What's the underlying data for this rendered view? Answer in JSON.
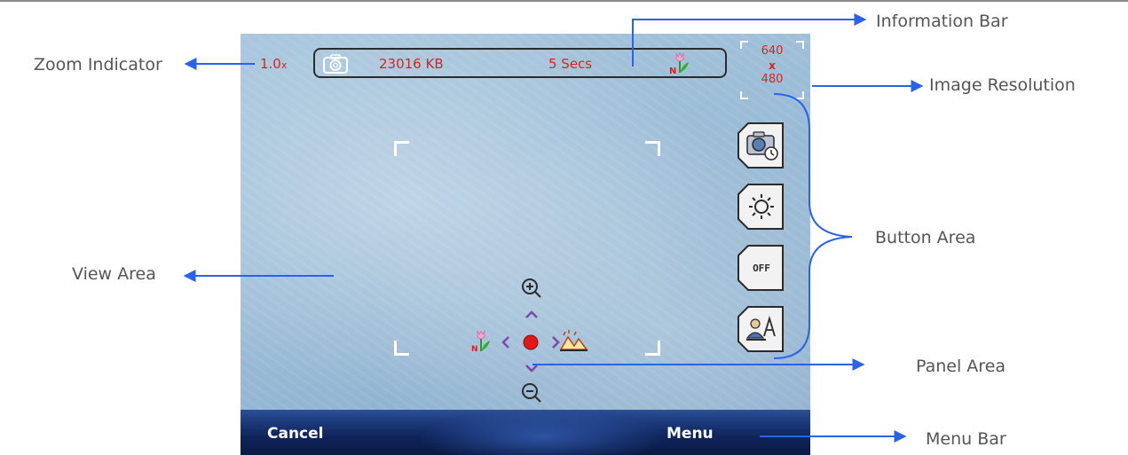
{
  "screen": {
    "zoom_value": "1.0",
    "zoom_suffix": "x",
    "info_bar": {
      "size": "23016 KB",
      "time": "5 Secs"
    },
    "resolution": {
      "width": "640",
      "times": "x",
      "height": "480"
    },
    "buttons": [
      {
        "icon": "camera-timer-icon"
      },
      {
        "icon": "brightness-icon"
      },
      {
        "icon": "flash-off-icon",
        "text": "OFF"
      },
      {
        "icon": "scene-mode-icon"
      }
    ],
    "panel": {
      "icons": [
        "zoom-in-icon",
        "arrow-up-icon",
        "scene-icon",
        "arrow-left-icon",
        "capture-dot-icon",
        "arrow-right-icon",
        "landscape-icon",
        "arrow-down-icon",
        "zoom-out-icon"
      ]
    },
    "menu_bar": {
      "left": "Cancel",
      "right": "Menu"
    }
  },
  "annotations": {
    "zoom_indicator": "Zoom Indicator",
    "information_bar": "Information Bar",
    "image_resolution": "Image Resolution",
    "button_area": "Button Area",
    "view_area": "View Area",
    "panel_area": "Panel Area",
    "menu_bar": "Menu Bar"
  },
  "colors": {
    "indicator_text": "#e02020",
    "annotation_arrow": "#2a62e8",
    "annotation_text": "#555555",
    "menu_bar_dark": "#0f245a"
  }
}
